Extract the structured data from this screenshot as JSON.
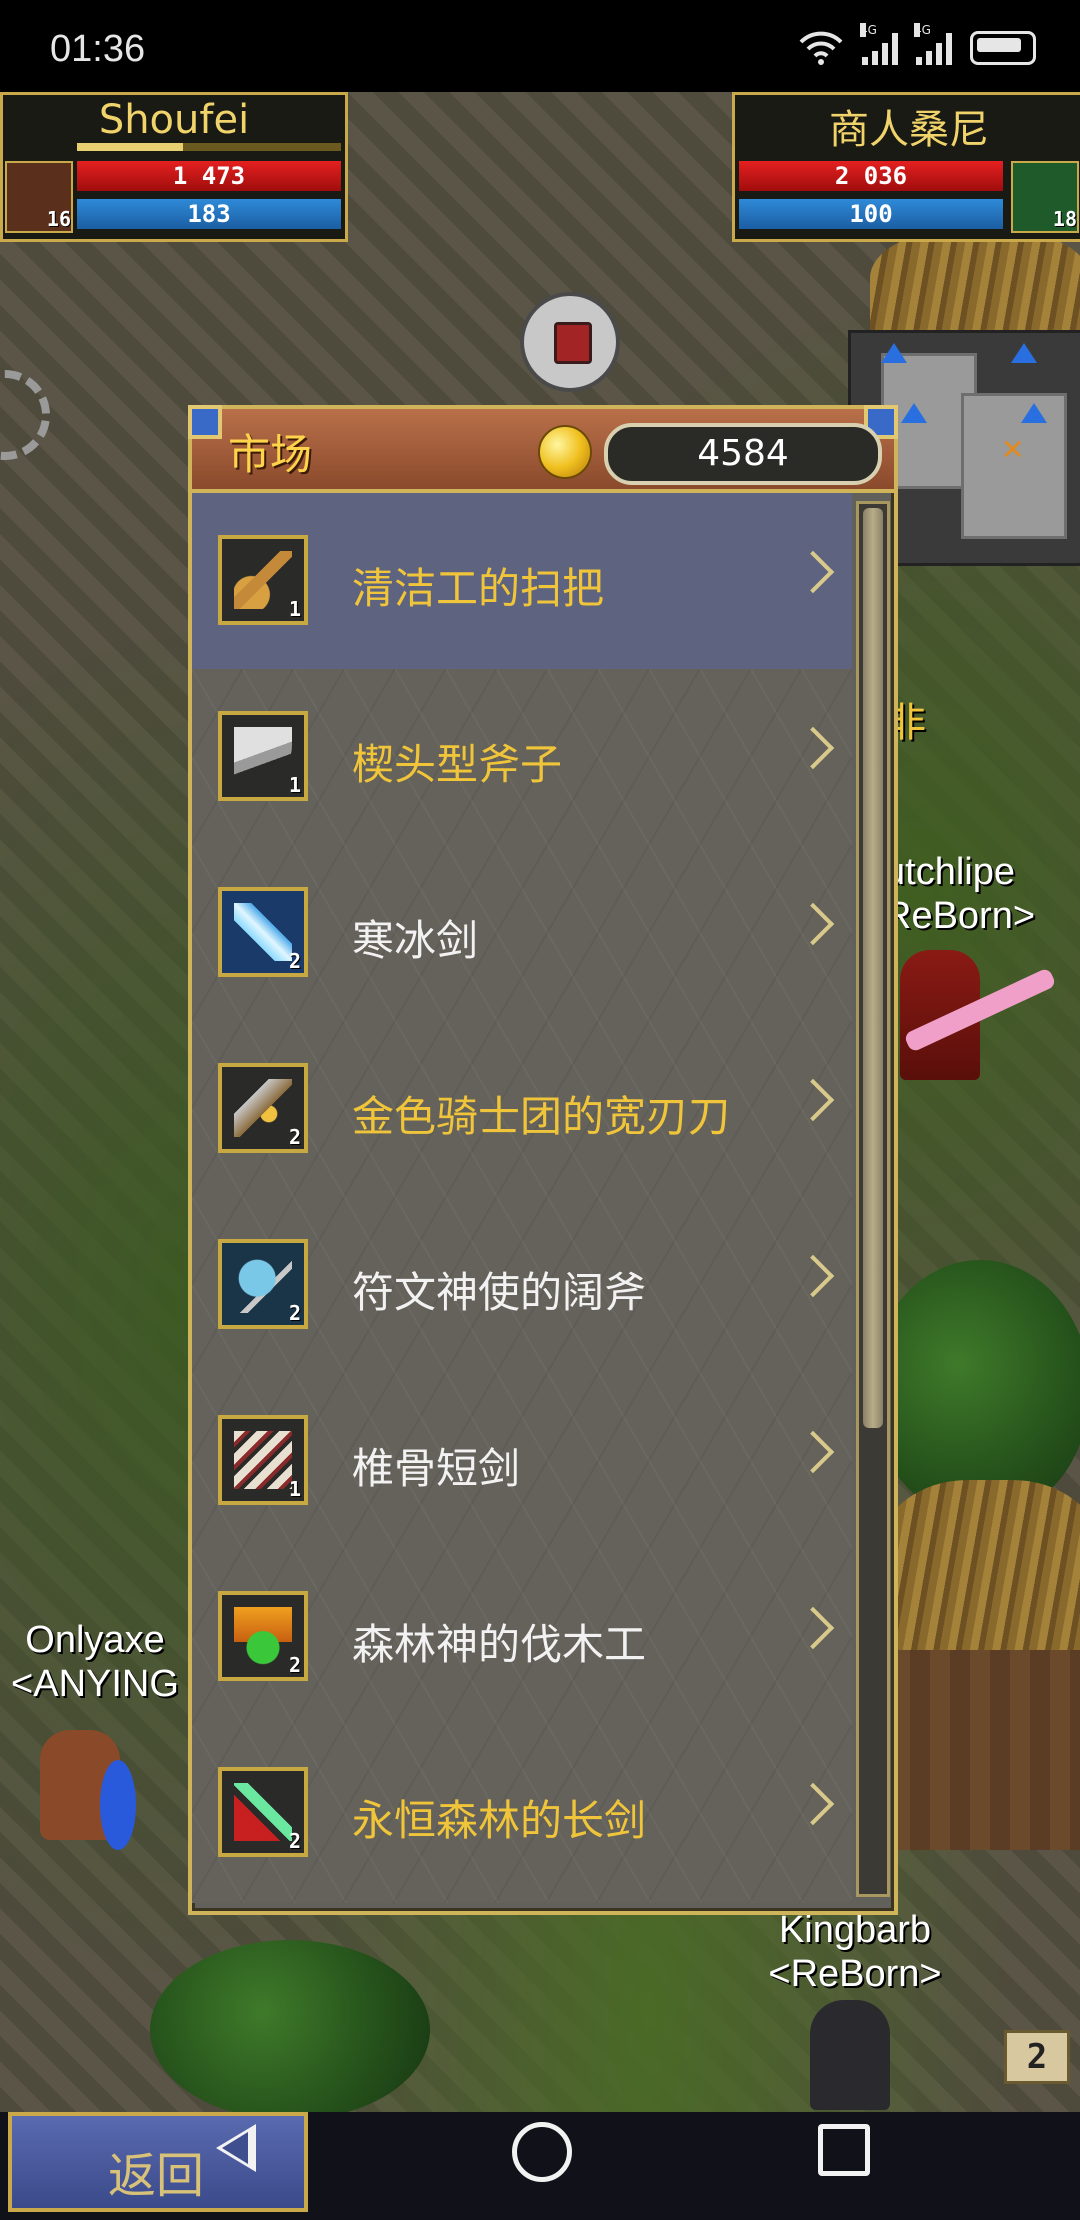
{
  "status_bar": {
    "time": "01:36",
    "network_1": "4G",
    "network_2": "4G"
  },
  "player": {
    "name": "Shoufei",
    "hp": "1 473",
    "mp": "183",
    "level": "16"
  },
  "target": {
    "name": "商人桑尼",
    "hp": "2 036",
    "mp": "100",
    "level": "18"
  },
  "market": {
    "title": "市场",
    "gold": "4584",
    "items": [
      {
        "name": "清洁工的扫把",
        "qty": "1",
        "color": "#f0c53a",
        "icon": "broom-icon"
      },
      {
        "name": "楔头型斧子",
        "qty": "1",
        "color": "#f0c53a",
        "icon": "axe-icon"
      },
      {
        "name": "寒冰剑",
        "qty": "2",
        "color": "#f2f2f2",
        "icon": "ice-sword-icon"
      },
      {
        "name": "金色骑士团的宽刃刀",
        "qty": "2",
        "color": "#f0c53a",
        "icon": "broadblade-icon"
      },
      {
        "name": "符文神使的阔斧",
        "qty": "2",
        "color": "#f2f2f2",
        "icon": "rune-axe-icon"
      },
      {
        "name": "椎骨短剑",
        "qty": "1",
        "color": "#f2f2f2",
        "icon": "bone-dagger-icon"
      },
      {
        "name": "森林神的伐木工",
        "qty": "2",
        "color": "#f2f2f2",
        "icon": "forest-axe-icon"
      },
      {
        "name": "永恒森林的长剑",
        "qty": "2",
        "color": "#f0c53a",
        "icon": "longsword-icon"
      }
    ]
  },
  "world_labels": {
    "player_right_1": "utchlipe",
    "player_right_2": "ReBorn>",
    "player_left_1": "Onlyaxe",
    "player_left_2": "<ANYING",
    "player_bottom_1": "Kingbarb",
    "player_bottom_2": "<ReBorn>",
    "fragment": "非"
  },
  "bottom": {
    "back_label": "返回",
    "badge": "2"
  }
}
